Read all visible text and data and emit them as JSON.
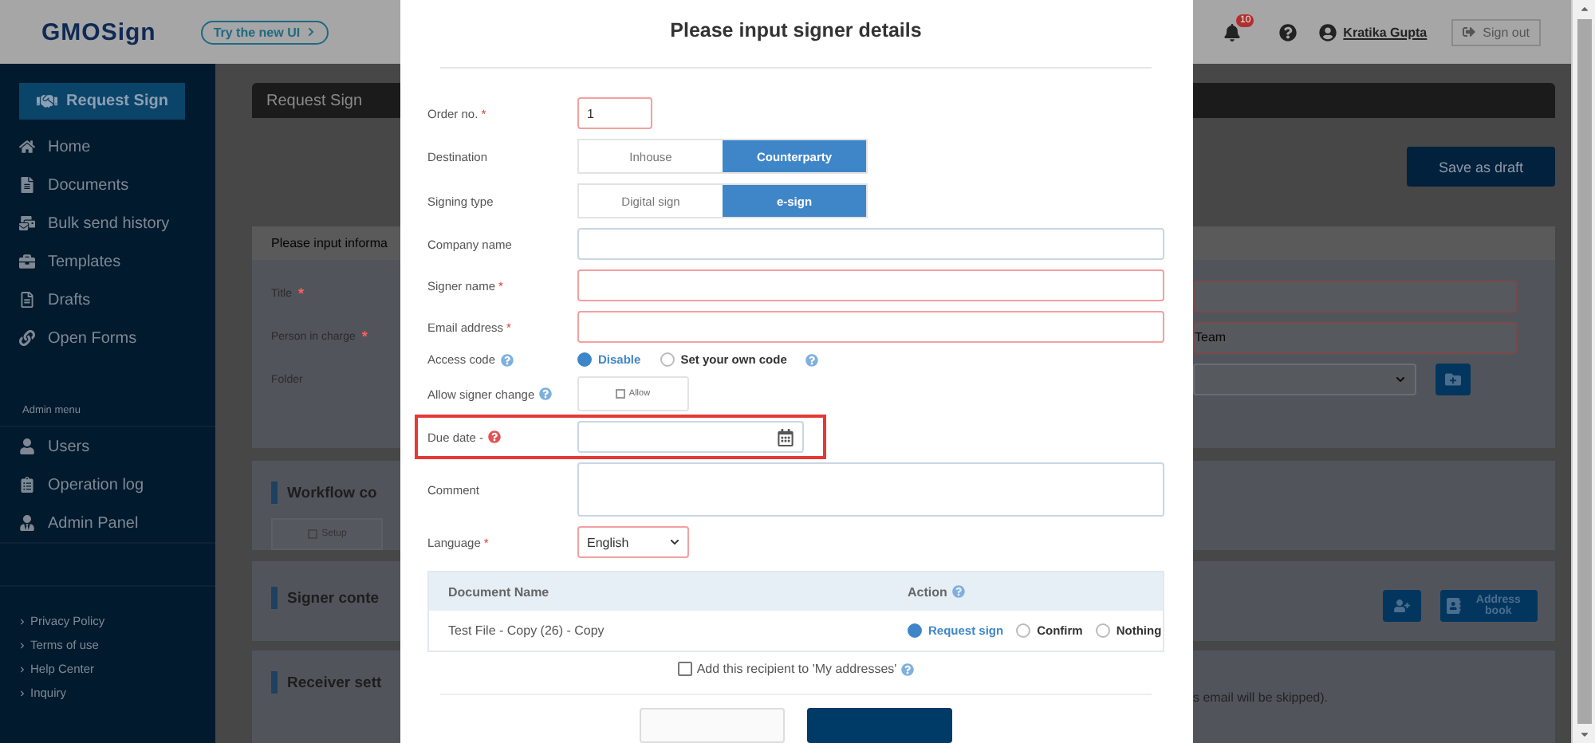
{
  "header": {
    "logo": "GMOSign",
    "try_new_ui": "Try the new UI",
    "notification_count": "10",
    "user_name": "Kratika Gupta",
    "sign_out": "Sign out"
  },
  "sidebar": {
    "request_button": "Request Sign",
    "items": [
      {
        "label": "Home"
      },
      {
        "label": "Documents"
      },
      {
        "label": "Bulk send history"
      },
      {
        "label": "Templates"
      },
      {
        "label": "Drafts"
      },
      {
        "label": "Open Forms"
      }
    ],
    "admin_heading": "Admin menu",
    "admin_items": [
      {
        "label": "Users"
      },
      {
        "label": "Operation log"
      },
      {
        "label": "Admin Panel"
      }
    ],
    "footer_links": [
      "Privacy Policy",
      "Terms of use",
      "Help Center",
      "Inquiry"
    ]
  },
  "page": {
    "title": "Request Sign",
    "save_draft": "Save as draft",
    "intro": "Please input informa",
    "fields": [
      {
        "label": "Title",
        "required_mark": "*"
      },
      {
        "label": "Person in charge",
        "required_mark": "*",
        "value": "Team"
      },
      {
        "label": "Folder"
      }
    ],
    "workflow": {
      "title": "Workflow co",
      "setup": "Setup"
    },
    "signer": {
      "title": "Signer conte",
      "address_book": "Address book"
    },
    "receiver": {
      "title": "Receiver sett",
      "note": "s email will be skipped)."
    }
  },
  "modal": {
    "title": "Please input signer details",
    "rows": [
      {
        "kind": "number",
        "label": "Order no.",
        "required_mark": "*",
        "value": "1"
      },
      {
        "kind": "toggle",
        "label": "Destination",
        "options": [
          {
            "label": "Inhouse",
            "selected": false
          },
          {
            "label": "Counterparty",
            "selected": true
          }
        ]
      },
      {
        "kind": "toggle",
        "label": "Signing type",
        "options": [
          {
            "label": "Digital sign",
            "selected": false
          },
          {
            "label": "e-sign",
            "selected": true
          }
        ]
      },
      {
        "kind": "text",
        "label": "Company name"
      },
      {
        "kind": "text",
        "label": "Signer name",
        "required_mark": "*"
      },
      {
        "kind": "text",
        "label": "Email address",
        "required_mark": "*"
      },
      {
        "kind": "radio",
        "label": "Access code",
        "help": true,
        "options": [
          {
            "label": "Disable",
            "selected": true
          },
          {
            "label": "Set your own code",
            "selected": false,
            "help": true
          }
        ]
      },
      {
        "kind": "checkbox",
        "label": "Allow signer change",
        "help": true,
        "option": "Allow",
        "checked": false
      },
      {
        "kind": "date",
        "label": "Due date -",
        "help": true,
        "help_alert": true,
        "highlighted": true
      },
      {
        "kind": "textarea",
        "label": "Comment"
      },
      {
        "kind": "select",
        "label": "Language",
        "required_mark": "*",
        "value": "English"
      }
    ],
    "table": {
      "columns": [
        {
          "label": "Document Name"
        },
        {
          "label": "Action",
          "help": true
        }
      ],
      "rows": [
        {
          "name": "Test File - Copy (26) - Copy",
          "actions": [
            {
              "label": "Request sign",
              "selected": true
            },
            {
              "label": "Confirm",
              "selected": false
            },
            {
              "label": "Nothing",
              "selected": false
            }
          ]
        }
      ]
    },
    "add_recipient": {
      "label": "Add this recipient to 'My addresses'",
      "checked": false,
      "help": true
    }
  }
}
